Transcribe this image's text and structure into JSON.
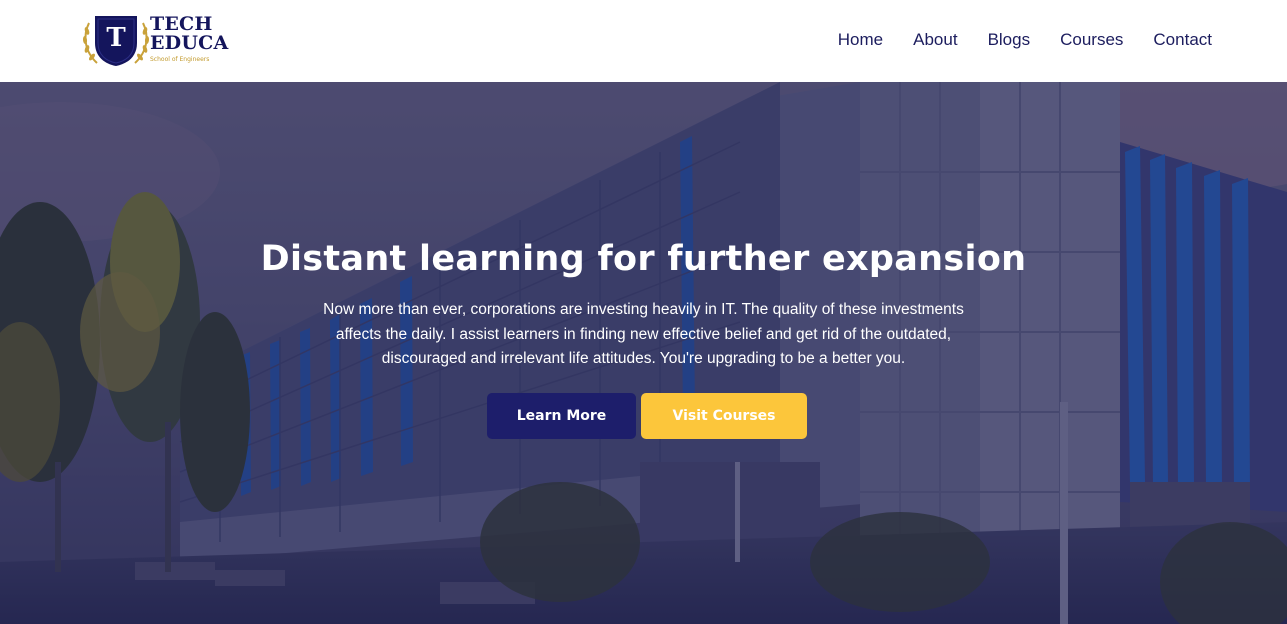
{
  "brand": {
    "line1": "TECH",
    "line2": "EDUCA",
    "tagline": "School of Engineers",
    "emblem_letter": "T"
  },
  "nav": {
    "items": [
      {
        "label": "Home"
      },
      {
        "label": "About"
      },
      {
        "label": "Blogs"
      },
      {
        "label": "Courses"
      },
      {
        "label": "Contact"
      }
    ]
  },
  "hero": {
    "title": "Distant learning for further expansion",
    "text": "Now more than ever, corporations are investing heavily in IT. The quality of these investments affects the daily. I assist learners in finding new effective belief and get rid of the outdated, discouraged and irrelevant life attitudes. You're upgrading to be a better you.",
    "learn_more_label": "Learn More",
    "visit_courses_label": "Visit Courses"
  },
  "colors": {
    "navy": "#1d1e6b",
    "gold": "#fcc63b",
    "nav_text": "#1c1d5e"
  }
}
